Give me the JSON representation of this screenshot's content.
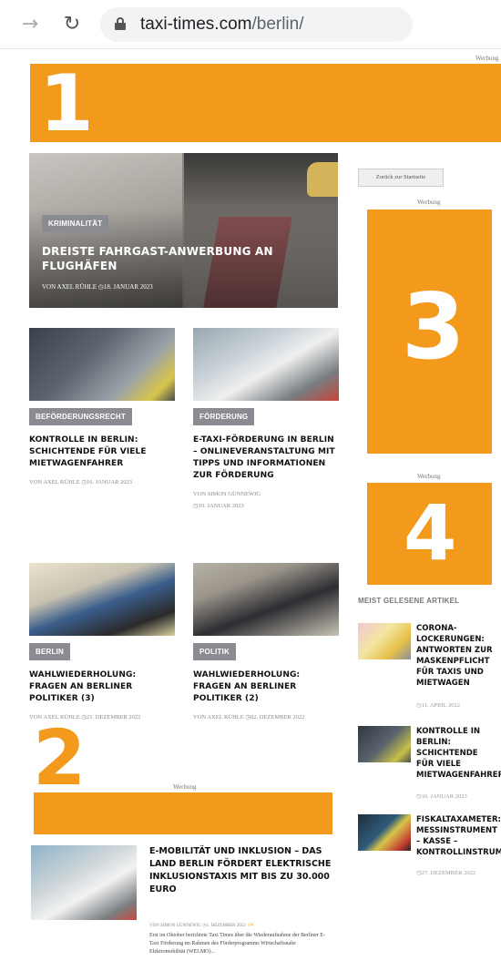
{
  "browser": {
    "url_domain": "taxi-times.com",
    "url_path": "/berlin/"
  },
  "ads": {
    "label": "Werbung",
    "ad1": "1",
    "ad2": "2",
    "ad3": "3",
    "ad4": "4"
  },
  "hero": {
    "tag": "KRIMINALITÄT",
    "title": "DREISTE FAHRGAST-ANWERBUNG AN FLUGHÄFEN",
    "meta": "VON AXEL RÜHLE   ◷18. JANUAR 2023"
  },
  "cards": [
    {
      "tag": "BEFÖRDERUNGSRECHT",
      "title": "KONTROLLE IN BERLIN: SCHICHTENDE FÜR VIELE MIETWAGENFAHRER",
      "meta": "VON AXEL RÜHLE  ◷16. JANUAR 2023"
    },
    {
      "tag": "FÖRDERUNG",
      "title": "E-TAXI-FÖRDERUNG IN BERLIN – ONLINEVERANSTALTUNG MIT TIPPS UND INFORMATIONEN ZUR FÖRDERUNG",
      "meta": "VON SIMON GÜNNEWIG",
      "meta2": "◷10. JANUAR 2023"
    },
    {
      "tag": "BERLIN",
      "title": "WAHLWIEDERHOLUNG: FRAGEN AN BERLINER POLITIKER (3)",
      "meta": "VON AXEL RÜHLE  ◷21. DEZEMBER 2022"
    },
    {
      "tag": "POLITIK",
      "title": "WAHLWIEDERHOLUNG: FRAGEN AN BERLINER POLITIKER (2)",
      "meta": "VON AXEL RÜHLE  ◷02. DEZEMBER 2022"
    }
  ],
  "bottom_article": {
    "title": "E-MOBILITÄT UND INKLUSION – DAS LAND BERLIN FÖRDERT ELEKTRISCHE INKLUSIONSTAXIS MIT BIS ZU 30.000 EURO",
    "meta": "VON SIMON GÜNNEWIG  ◷1. DEZEMBER 2022",
    "comments": "0",
    "excerpt": "Erst im Oktober berichtete Taxi Times über die Wiederaufnahme der Berliner E-Taxi Förderung im Rahmen des Förderprogramms Wirtschaftsnahe Elektromobilität (WELMO)..."
  },
  "sidebar": {
    "back_button": "Zurück zur Startseite",
    "most_read_heading": "MEIST GELESENE ARTIKEL",
    "items": [
      {
        "title_lines": [
          "CORONA-",
          "LOCKERUNGEN:",
          "ANTWORTEN ZUR",
          "MASKENPFLICHT",
          "FÜR TAXIS UND",
          "MIETWAGEN"
        ],
        "date": "◷11. APRIL 2022"
      },
      {
        "title_lines": [
          "KONTROLLE IN",
          "BERLIN:",
          "SCHICHTENDE",
          "FÜR VIELE",
          "MIETWAGENFAHRER"
        ],
        "date": "◷16. JANUAR 2023"
      },
      {
        "title_lines": [
          "FISKALTAXAMETER:",
          "MESSINSTRUMENT",
          "– KASSE –",
          "KONTROLLINSTRUMENT"
        ],
        "date": "◷27. DEZEMBER 2022"
      }
    ]
  }
}
